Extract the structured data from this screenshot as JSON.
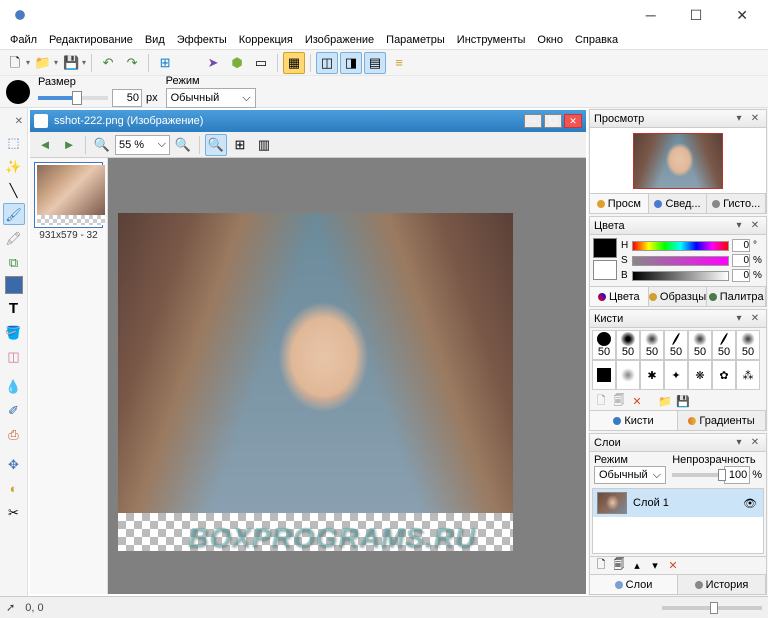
{
  "menubar": [
    "Файл",
    "Редактирование",
    "Вид",
    "Эффекты",
    "Коррекция",
    "Изображение",
    "Параметры",
    "Инструменты",
    "Окно",
    "Справка"
  ],
  "options": {
    "size_label": "Размер",
    "size_value": "50",
    "size_unit": "px",
    "mode_label": "Режим",
    "mode_value": "Обычный"
  },
  "document": {
    "title": "sshot-222.png (Изображение)",
    "zoom": "55 %",
    "thumb_info": "931x579 - 32"
  },
  "watermark": "BOXPROGRAMS.RU",
  "panels": {
    "preview": {
      "title": "Просмотр",
      "tabs": [
        "Просм",
        "Свед...",
        "Гисто..."
      ]
    },
    "colors": {
      "title": "Цвета",
      "h": {
        "label": "H",
        "value": "0",
        "unit": "°"
      },
      "s": {
        "label": "S",
        "value": "0",
        "unit": "%"
      },
      "b": {
        "label": "B",
        "value": "0",
        "unit": "%"
      },
      "tabs": [
        "Цвета",
        "Образцы",
        "Палитра"
      ]
    },
    "brushes": {
      "title": "Кисти",
      "sizes": [
        "50",
        "50",
        "50",
        "50",
        "50",
        "50",
        "50"
      ],
      "tabs": [
        "Кисти",
        "Градиенты"
      ]
    },
    "layers": {
      "title": "Слои",
      "mode_label": "Режим",
      "opacity_label": "Непрозрачность",
      "mode_value": "Обычный",
      "opacity_value": "100",
      "opacity_unit": "%",
      "layer1_name": "Слой 1",
      "tabs": [
        "Слои",
        "История"
      ]
    }
  },
  "status": {
    "arrow": "➚",
    "coords": "0, 0"
  }
}
